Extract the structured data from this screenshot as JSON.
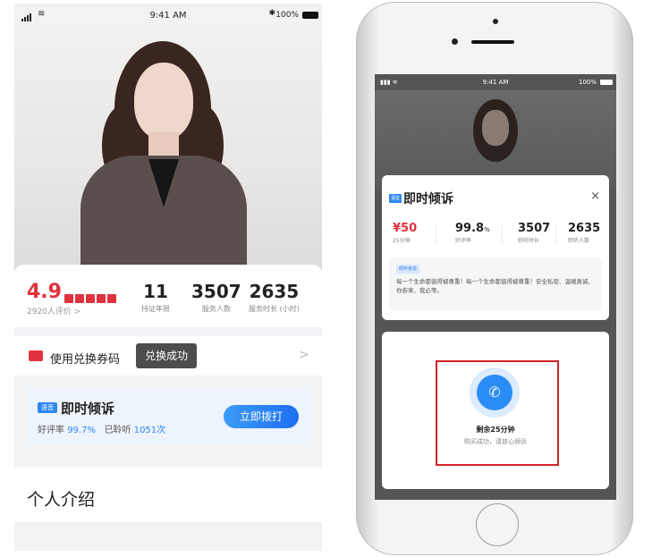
{
  "status_bar": {
    "time": "9:41 AM",
    "battery": "100%"
  },
  "left_screen": {
    "rating": {
      "score": "4.9",
      "stars": 5,
      "reviews": "2920人评价 >"
    },
    "stats": [
      {
        "value": "11",
        "label": "持证年限"
      },
      {
        "value": "3507",
        "label": "服务人数"
      },
      {
        "value": "2635",
        "label": "服务时长 (小时)"
      }
    ],
    "coupon": {
      "label": "使用兑换券码",
      "toast": "兑换成功",
      "chevron": ">"
    },
    "call_card": {
      "badge": "语音",
      "title": "即时倾诉",
      "rate_label": "好评率",
      "rate_value": "99.7%",
      "heard_label": "已聆听",
      "heard_value": "1051次",
      "button": "立即拨打"
    },
    "intro_title": "个人介绍"
  },
  "right_screen": {
    "status_bar": {
      "time": "9:41 AM",
      "battery": "100%"
    },
    "sheet": {
      "badge": "语音",
      "title": "即时倾诉",
      "close": "×",
      "price": {
        "value": "¥50",
        "label": "25分钟"
      },
      "stats": [
        {
          "value": "99.8",
          "unit": "%",
          "label": "好评率"
        },
        {
          "value": "3507",
          "label": "聆听时长"
        },
        {
          "value": "2635",
          "label": "聆听人数"
        }
      ],
      "quote_tag": "倾听者说",
      "quote": "每一个生命都值得被尊重！每一个生命都值得被尊重！安全私密、温暖真诚、你若来、我必等。"
    },
    "result": {
      "remaining": "剩余25分钟",
      "message": "购买成功，请放心倾诉"
    }
  },
  "colors": {
    "accent": "#2f86f6",
    "price_red": "#e0323e",
    "highlight_border": "#d2232a",
    "toast_bg": "#4d4d4d"
  }
}
